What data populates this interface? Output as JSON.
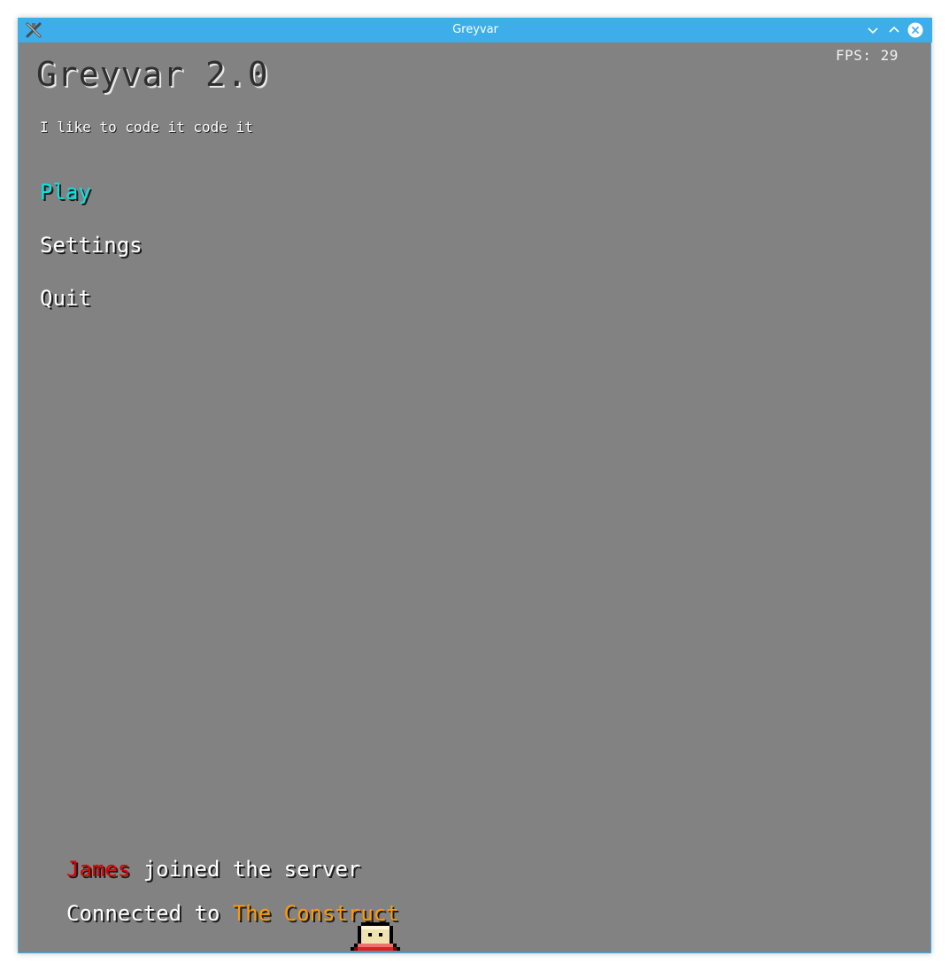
{
  "window": {
    "title": "Greyvar",
    "accent_color": "#3daee9",
    "icons": [
      "app-icon",
      "minimize-icon",
      "maximize-icon",
      "close-icon"
    ]
  },
  "hud": {
    "fps": "FPS: 29"
  },
  "header": {
    "title": "Greyvar 2.0",
    "subtitle": "I like to code it code it"
  },
  "menu": {
    "items": [
      {
        "label": "Play",
        "selected": true,
        "color": "#00e5e5"
      },
      {
        "label": "Settings",
        "selected": false
      },
      {
        "label": "Quit",
        "selected": false
      }
    ]
  },
  "chat": {
    "join": {
      "player": "James",
      "text": " joined the server",
      "player_color": "#e00000"
    },
    "connected": {
      "prefix": "Connected to ",
      "server": "The Construct",
      "server_color": "#ff9900"
    }
  },
  "colors": {
    "background": "#828282"
  }
}
